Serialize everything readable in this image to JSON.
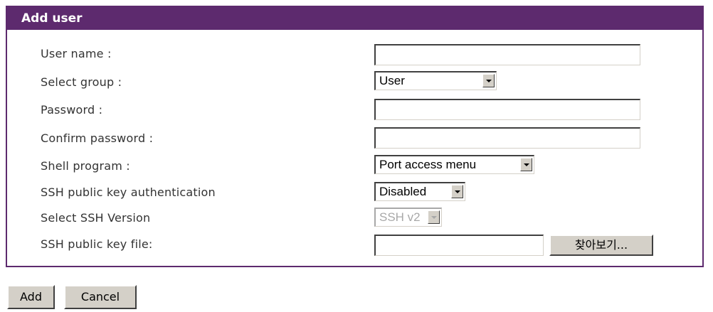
{
  "panel": {
    "title": "Add user"
  },
  "form": {
    "user_name_label": "User name :",
    "select_group_label": "Select group :",
    "select_group_value": "User",
    "password_label": "Password :",
    "confirm_password_label": "Confirm password :",
    "shell_program_label": "Shell program :",
    "shell_program_value": "Port access menu",
    "ssh_auth_label": "SSH public key authentication",
    "ssh_auth_value": "Disabled",
    "ssh_version_label": "Select SSH Version",
    "ssh_version_value": "SSH v2",
    "ssh_key_file_label": "SSH public key file:",
    "browse_label": "찾아보기..."
  },
  "actions": {
    "add_label": "Add",
    "cancel_label": "Cancel"
  },
  "colors": {
    "header": "#5d2a6e",
    "button_face": "#d4d0c8"
  }
}
